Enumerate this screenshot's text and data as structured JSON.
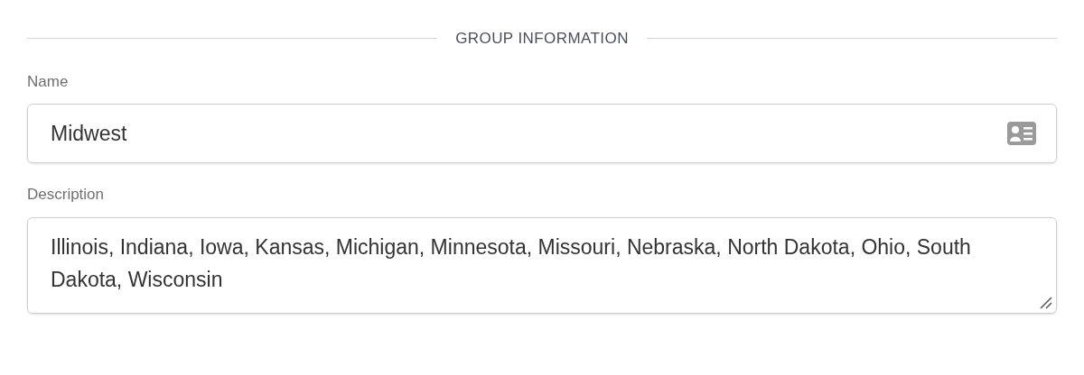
{
  "section_title": "GROUP INFORMATION",
  "fields": [
    {
      "kind": "input",
      "label": "Name",
      "value": "Midwest"
    },
    {
      "kind": "textarea",
      "label": "Description",
      "value": "Illinois, Indiana, Iowa, Kansas, Michigan, Minnesota, Missouri, Nebraska, North Dakota, Ohio, South Dakota, Wisconsin"
    }
  ]
}
